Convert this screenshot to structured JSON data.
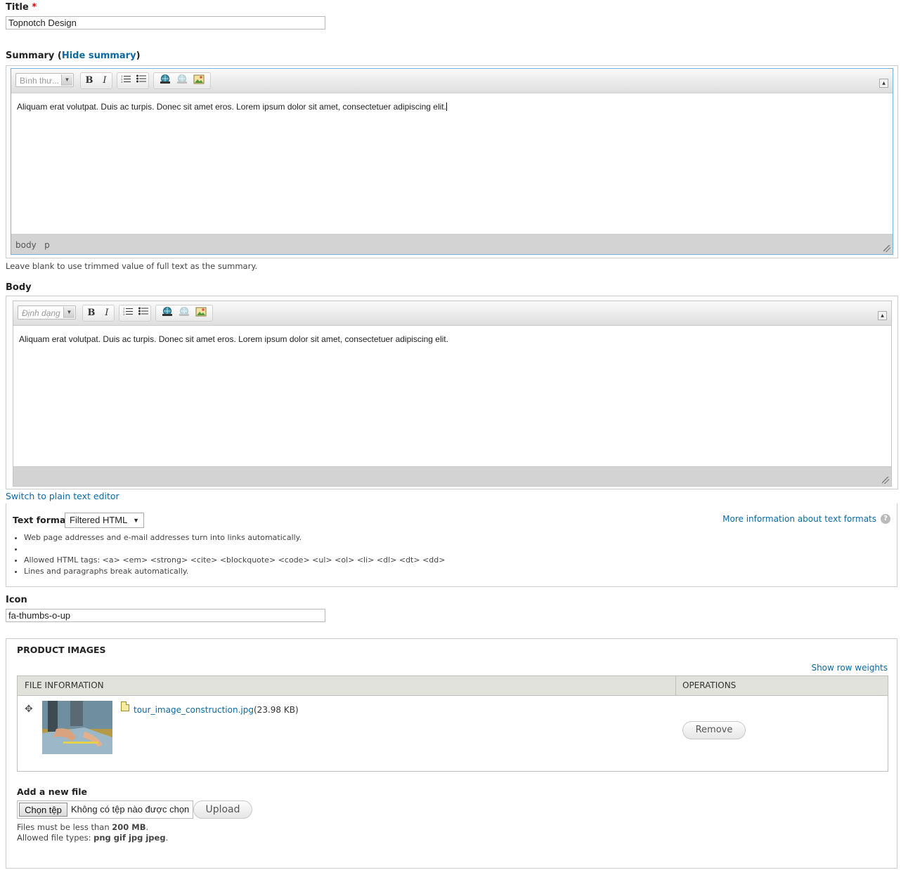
{
  "title_field": {
    "label": "Title",
    "required_mark": "*",
    "value": "Topnotch Design"
  },
  "summary": {
    "label": "Summary (",
    "toggle_link": "Hide summary",
    "label_close": ")",
    "format_select": "Bình thư...",
    "content": "Aliquam erat volutpat. Duis ac turpis. Donec sit amet eros. Lorem ipsum dolor sit amet, consectetuer adipiscing elit.",
    "path": [
      "body",
      "p"
    ],
    "help": "Leave blank to use trimmed value of full text as the summary."
  },
  "body_field": {
    "label": "Body",
    "format_select": "Định dạng",
    "content": "Aliquam erat volutpat. Duis ac turpis. Donec sit amet eros. Lorem ipsum dolor sit amet, consectetuer adipiscing elit.",
    "switch_link": "Switch to plain text editor"
  },
  "toolbar": {
    "bold": "B",
    "italic": "I"
  },
  "text_format": {
    "label": "Text format",
    "selected": "Filtered HTML",
    "more_info": "More information about text formats",
    "tips": [
      "Web page addresses and e-mail addresses turn into links automatically.",
      "",
      "Allowed HTML tags: <a> <em> <strong> <cite> <blockquote> <code> <ul> <ol> <li> <dl> <dt> <dd>",
      "Lines and paragraphs break automatically."
    ]
  },
  "icon_field": {
    "label": "Icon",
    "value": "fa-thumbs-o-up"
  },
  "product_images": {
    "legend": "PRODUCT IMAGES",
    "show_weights": "Show row weights",
    "columns": [
      "FILE INFORMATION",
      "OPERATIONS"
    ],
    "file": {
      "name": "tour_image_construction.jpg",
      "size": "(23.98 KB)"
    },
    "remove_label": "Remove",
    "add_label": "Add a new file",
    "choose_button": "Chọn tệp",
    "no_file_text": "Không có tệp nào được chọn",
    "upload_label": "Upload",
    "limit_prefix": "Files must be less than ",
    "limit_value": "200 MB",
    "limit_suffix": ".",
    "types_prefix": "Allowed file types: ",
    "types_value": "png gif jpg jpeg",
    "types_suffix": "."
  },
  "colors": {
    "link": "#0b69a3",
    "required": "#dd0000",
    "focus_border": "#7ab1e0"
  }
}
